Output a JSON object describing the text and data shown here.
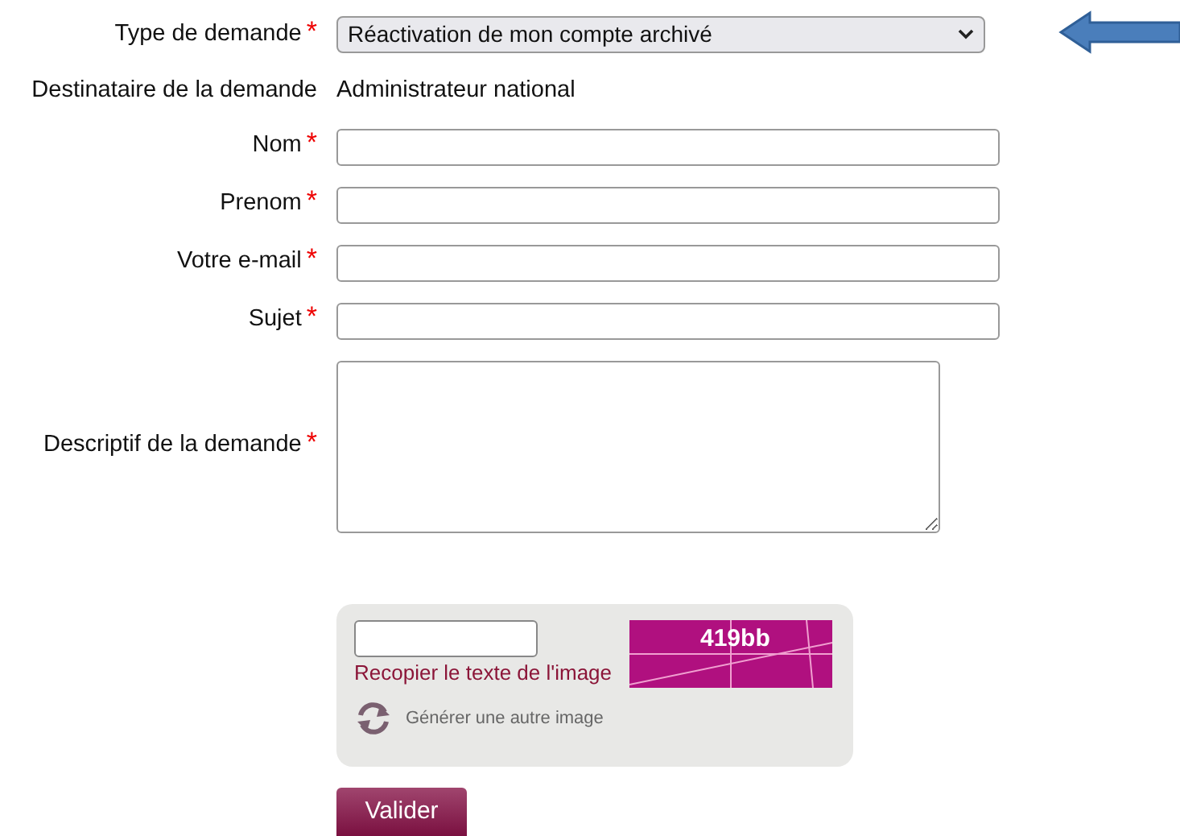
{
  "fields": [
    {
      "kind": "select",
      "label": "Type de demande",
      "required_mark": "*",
      "value": "Réactivation de mon compte archivé"
    },
    {
      "kind": "static",
      "label": "Destinataire de la demande",
      "value": "Administrateur national"
    },
    {
      "kind": "input",
      "label": "Nom",
      "required_mark": "*"
    },
    {
      "kind": "input",
      "label": "Prenom",
      "required_mark": "*"
    },
    {
      "kind": "input",
      "label": "Votre e-mail",
      "required_mark": "*"
    },
    {
      "kind": "input",
      "label": "Sujet",
      "required_mark": "*"
    },
    {
      "kind": "textarea",
      "label": "Descriptif de la demande",
      "required_mark": "*"
    }
  ],
  "captcha": {
    "hint": "Recopier le texte de l'image",
    "image_text": "419bb",
    "refresh": "Générer une autre image"
  },
  "submit": "Valider"
}
